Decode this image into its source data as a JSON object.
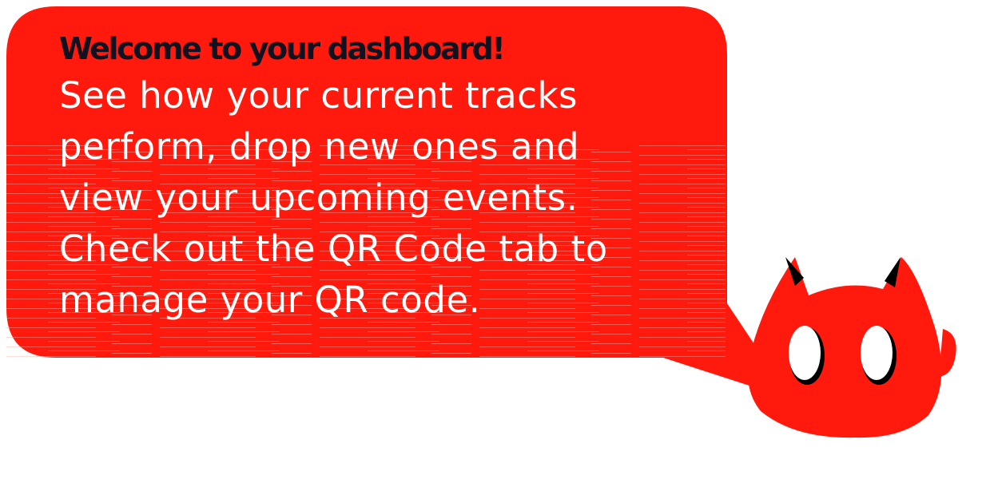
{
  "tooltip": {
    "headline": "Welcome to your dashboard!",
    "lines": [
      "See how your current tracks",
      "perform, drop new ones and",
      "view your upcoming events.",
      "Check out the QR Code tab to",
      "manage your QR code."
    ]
  },
  "mascot": {
    "icon": "red-devil-cat-mascot-icon"
  },
  "colors": {
    "bubble": "#ff1a0d",
    "headline": "#11111f",
    "body_text": "#ffffff",
    "mascot_body": "#ff1a0d",
    "horns": "#000000",
    "eyes": "#ffffff"
  }
}
